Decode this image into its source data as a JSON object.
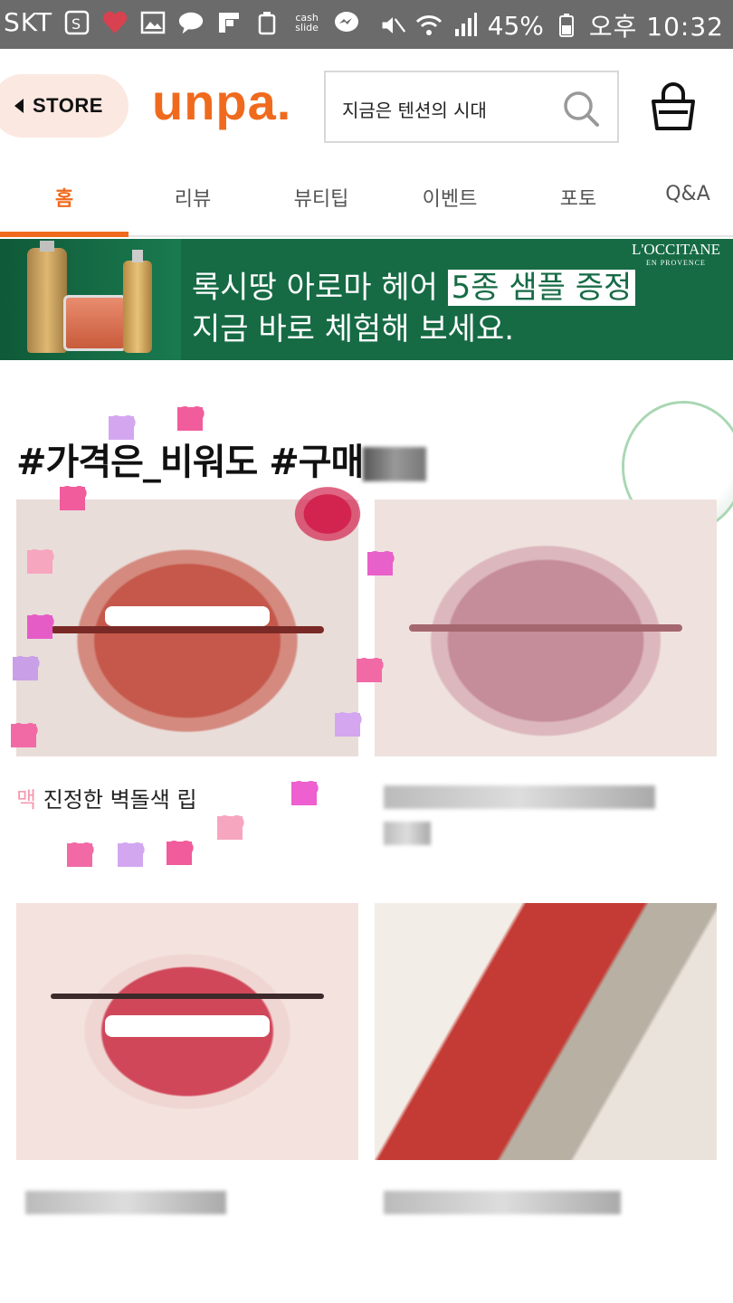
{
  "status_bar": {
    "carrier": "SKT",
    "battery": "45%",
    "time": "오후 10:32",
    "icons": [
      "s-icon",
      "heart-icon",
      "gallery-icon",
      "talk-icon",
      "flipboard-icon",
      "recycle-icon",
      "cashslide-icon",
      "messenger-icon",
      "mute-icon",
      "wifi-icon",
      "signal-icon",
      "battery-icon"
    ],
    "talk_label": "TALK",
    "cashslide_label": "cash slide"
  },
  "header": {
    "store_label": "STORE",
    "logo": "unpa.",
    "search_value": "지금은 텐션의 시대",
    "accent_color": "#f06a1e"
  },
  "tabs": [
    "홈",
    "리뷰",
    "뷰티팁",
    "이벤트",
    "포토",
    "Q&A"
  ],
  "banner": {
    "line1_prefix": "록시땅 아로마 헤어 ",
    "line1_highlight": "5종 샘플 증정",
    "line2": "지금 바로 체험해 보세요.",
    "brand": "L'OCCITANE",
    "brand_sub": "EN PROVENCE",
    "bg_color": "#166b45"
  },
  "section": {
    "title": "#가격은_비워도 #구매"
  },
  "cards": [
    {
      "title_prefix": "맥",
      "title": " 진정한 벽돌색 립"
    }
  ]
}
